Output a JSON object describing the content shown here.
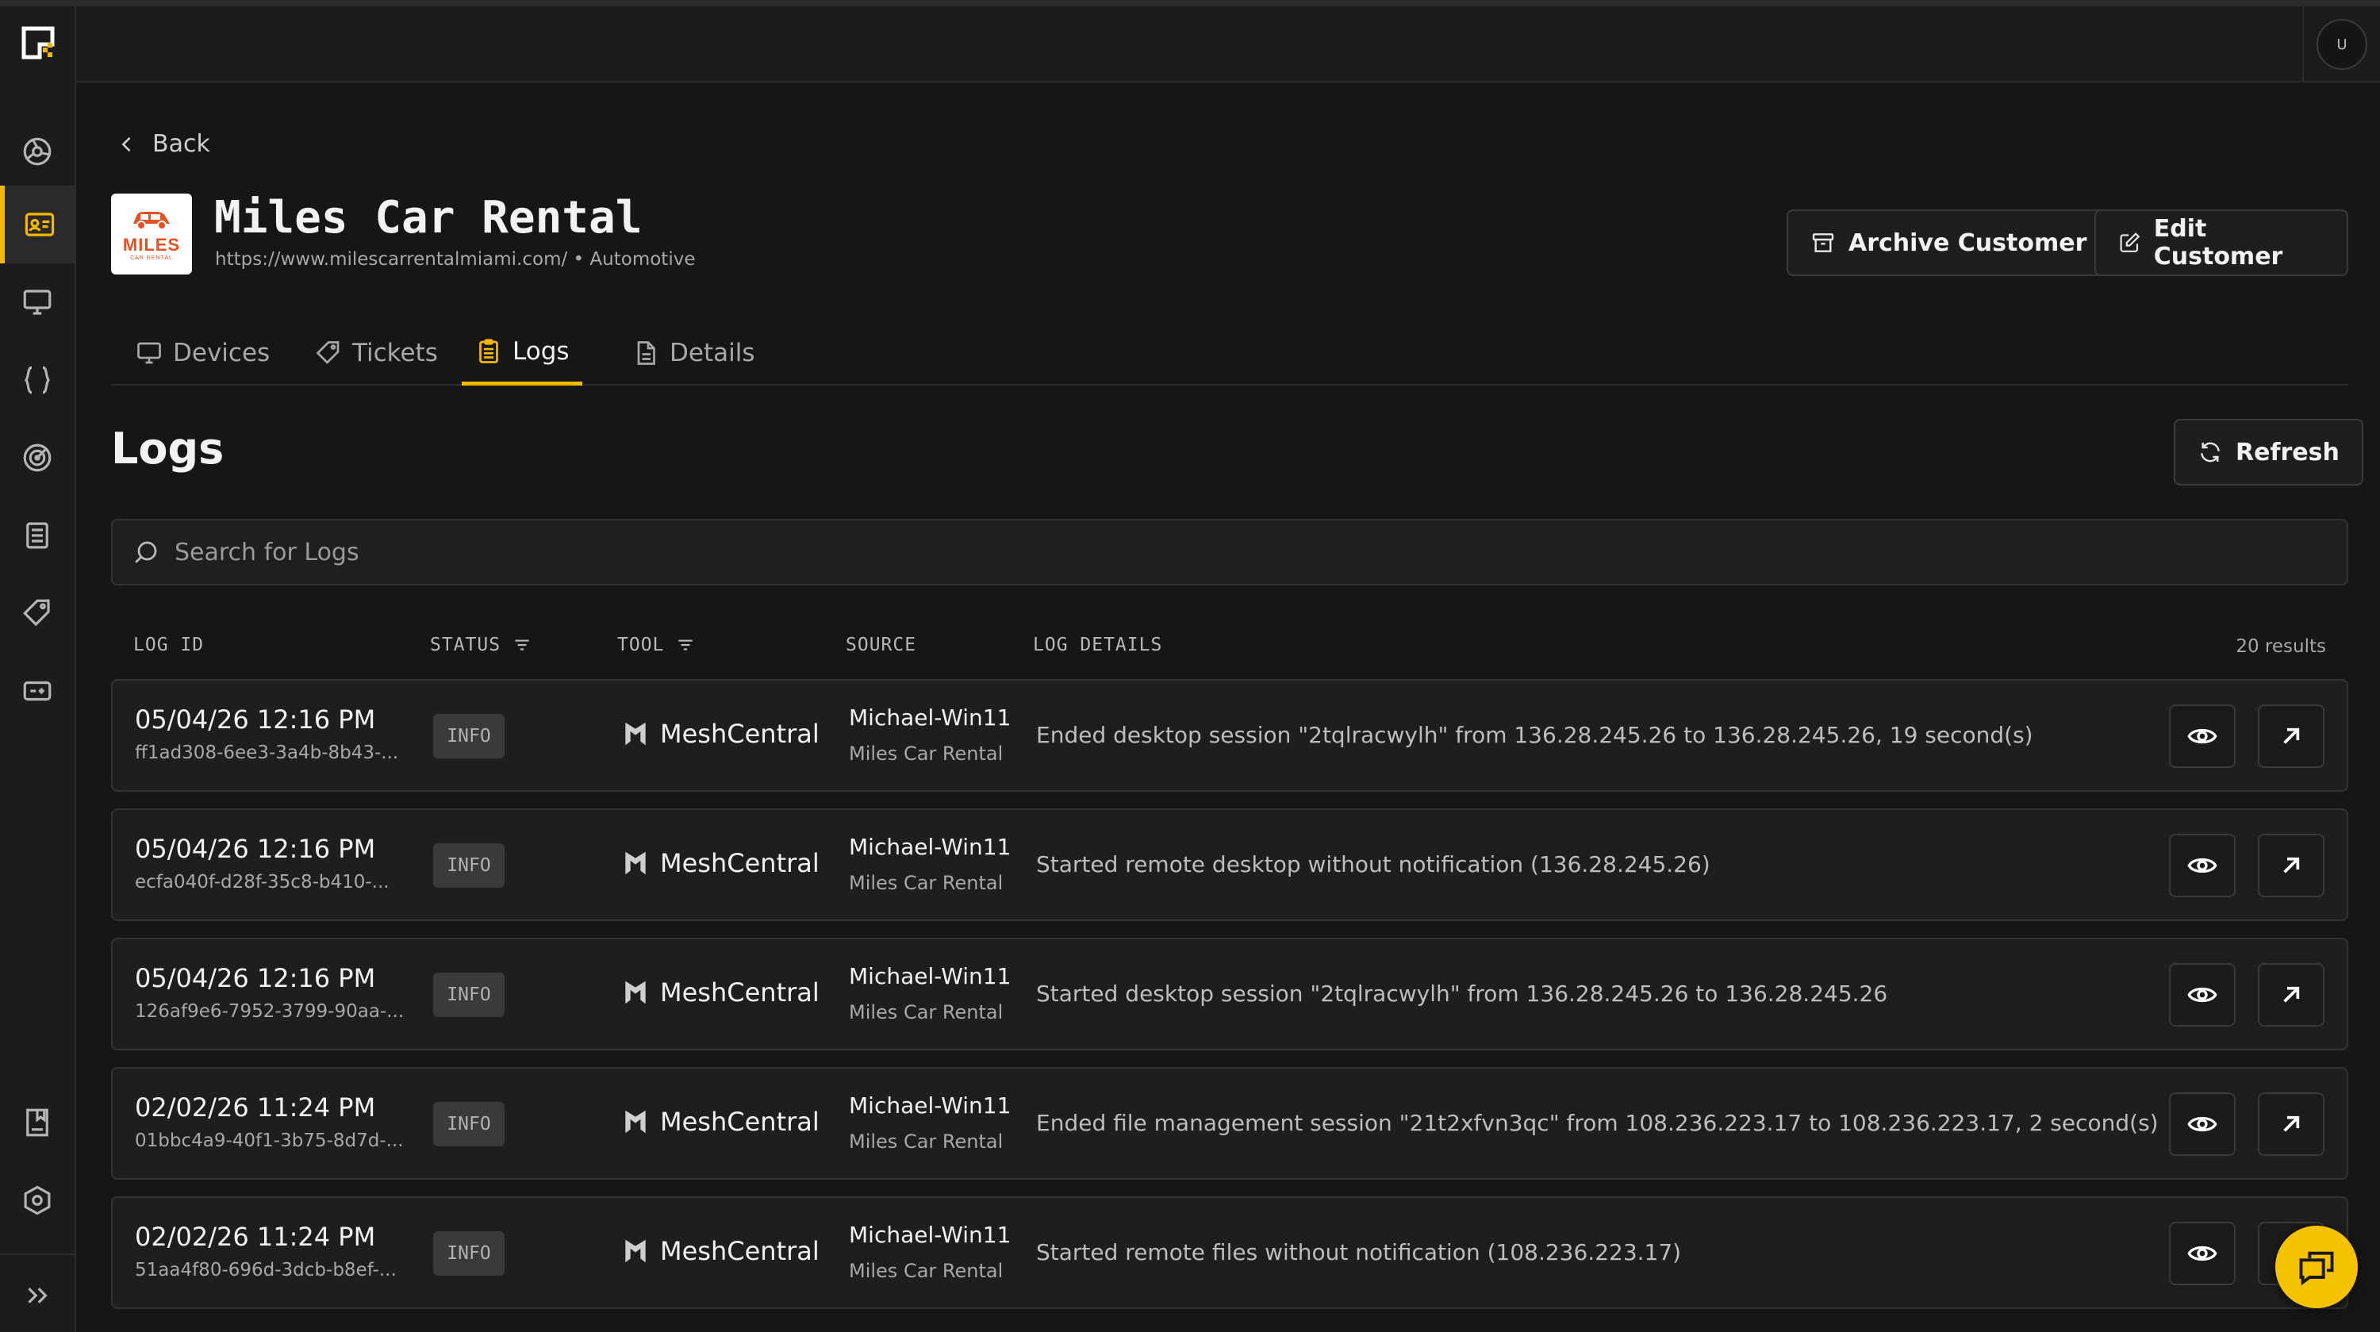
{
  "header": {
    "avatar_initial": "U"
  },
  "sidebar": {
    "items": [
      {
        "icon": "dashboard-icon"
      },
      {
        "icon": "customers-icon",
        "active": true
      },
      {
        "icon": "devices-icon"
      },
      {
        "icon": "scripts-icon"
      },
      {
        "icon": "monitoring-icon"
      },
      {
        "icon": "logs-icon"
      },
      {
        "icon": "tickets-icon"
      },
      {
        "icon": "integrations-icon"
      },
      {
        "icon": "docs-icon"
      },
      {
        "icon": "settings-icon"
      },
      {
        "icon": "expand-icon"
      }
    ]
  },
  "customer": {
    "back_label": "Back",
    "logo_text": "MILES",
    "logo_sub": "CAR RENTAL",
    "name": "Miles Car Rental",
    "meta": "https://www.milescarrentalmiami.com/ • Automotive",
    "archive_label": "Archive Customer",
    "edit_label": "Edit Customer"
  },
  "tabs": [
    {
      "label": "Devices",
      "icon": "monitor-icon"
    },
    {
      "label": "Tickets",
      "icon": "tag-icon"
    },
    {
      "label": "Logs",
      "icon": "clipboard-icon",
      "active": true
    },
    {
      "label": "Details",
      "icon": "file-icon"
    }
  ],
  "logs": {
    "title": "Logs",
    "refresh_label": "Refresh",
    "search_placeholder": "Search for Logs",
    "columns": {
      "log_id": "LOG ID",
      "status": "STATUS",
      "tool": "TOOL",
      "source": "SOURCE",
      "details": "LOG DETAILS"
    },
    "results": "20 results",
    "rows": [
      {
        "date": "05/04/26 12:16 PM",
        "id": "ff1ad308-6ee3-3a4b-8b43-...",
        "status": "INFO",
        "tool": "MeshCentral",
        "source_device": "Michael-Win11",
        "source_org": "Miles Car Rental",
        "details": "Ended desktop session \"2tqlracwylh\" from 136.28.245.26 to 136.28.245.26, 19 second(s)"
      },
      {
        "date": "05/04/26 12:16 PM",
        "id": "ecfa040f-d28f-35c8-b410-...",
        "status": "INFO",
        "tool": "MeshCentral",
        "source_device": "Michael-Win11",
        "source_org": "Miles Car Rental",
        "details": "Started remote desktop without notification (136.28.245.26)"
      },
      {
        "date": "05/04/26 12:16 PM",
        "id": "126af9e6-7952-3799-90aa-...",
        "status": "INFO",
        "tool": "MeshCentral",
        "source_device": "Michael-Win11",
        "source_org": "Miles Car Rental",
        "details": "Started desktop session \"2tqlracwylh\" from 136.28.245.26 to 136.28.245.26"
      },
      {
        "date": "02/02/26 11:24 PM",
        "id": "01bbc4a9-40f1-3b75-8d7d-...",
        "status": "INFO",
        "tool": "MeshCentral",
        "source_device": "Michael-Win11",
        "source_org": "Miles Car Rental",
        "details": "Ended file management session \"21t2xfvn3qc\" from 108.236.223.17 to 108.236.223.17, 2 second(s)"
      },
      {
        "date": "02/02/26 11:24 PM",
        "id": "51aa4f80-696d-3dcb-b8ef-...",
        "status": "INFO",
        "tool": "MeshCentral",
        "source_device": "Michael-Win11",
        "source_org": "Miles Car Rental",
        "details": "Started remote files without notification (108.236.223.17)"
      }
    ]
  },
  "colors": {
    "accent": "#f5b800",
    "background": "#161616",
    "panel": "#1e1e1e"
  }
}
